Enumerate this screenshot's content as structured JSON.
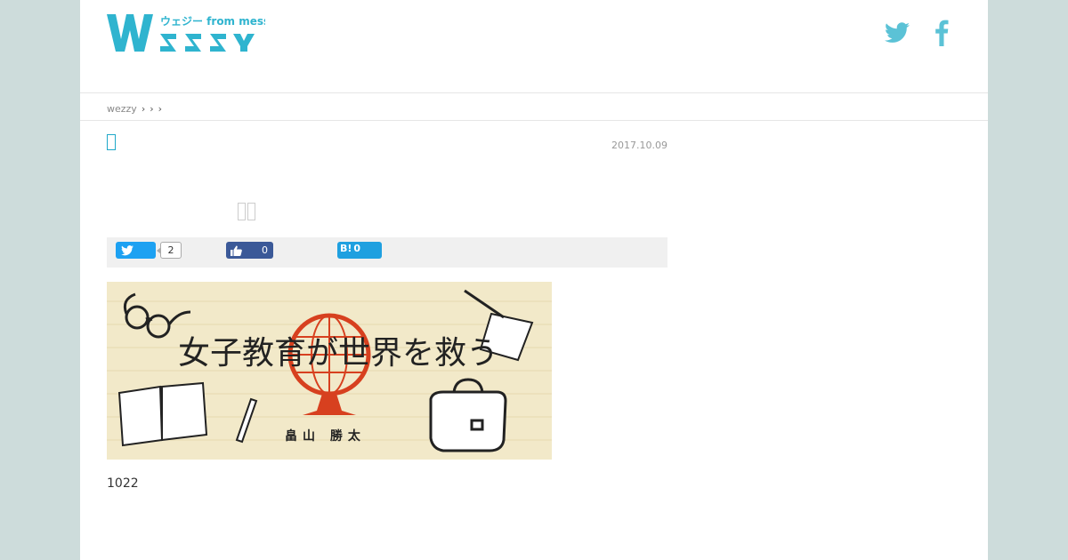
{
  "site": {
    "logo_text": "WEZZY",
    "logo_sub": "ウェジー from messy"
  },
  "social": {
    "twitter_icon": "twitter-icon",
    "facebook_icon": "facebook-icon",
    "color": "#5bc2d6"
  },
  "breadcrumb": {
    "home": "wezzy",
    "sep": "›"
  },
  "article": {
    "date": "2017.10.09",
    "body": "1022"
  },
  "share": {
    "twitter_count": "2",
    "facebook_count": "0",
    "hatena_label": "B!",
    "hatena_count": "0"
  },
  "hero": {
    "title": "女子教育が世界を救う",
    "author": "畠山 勝太"
  }
}
